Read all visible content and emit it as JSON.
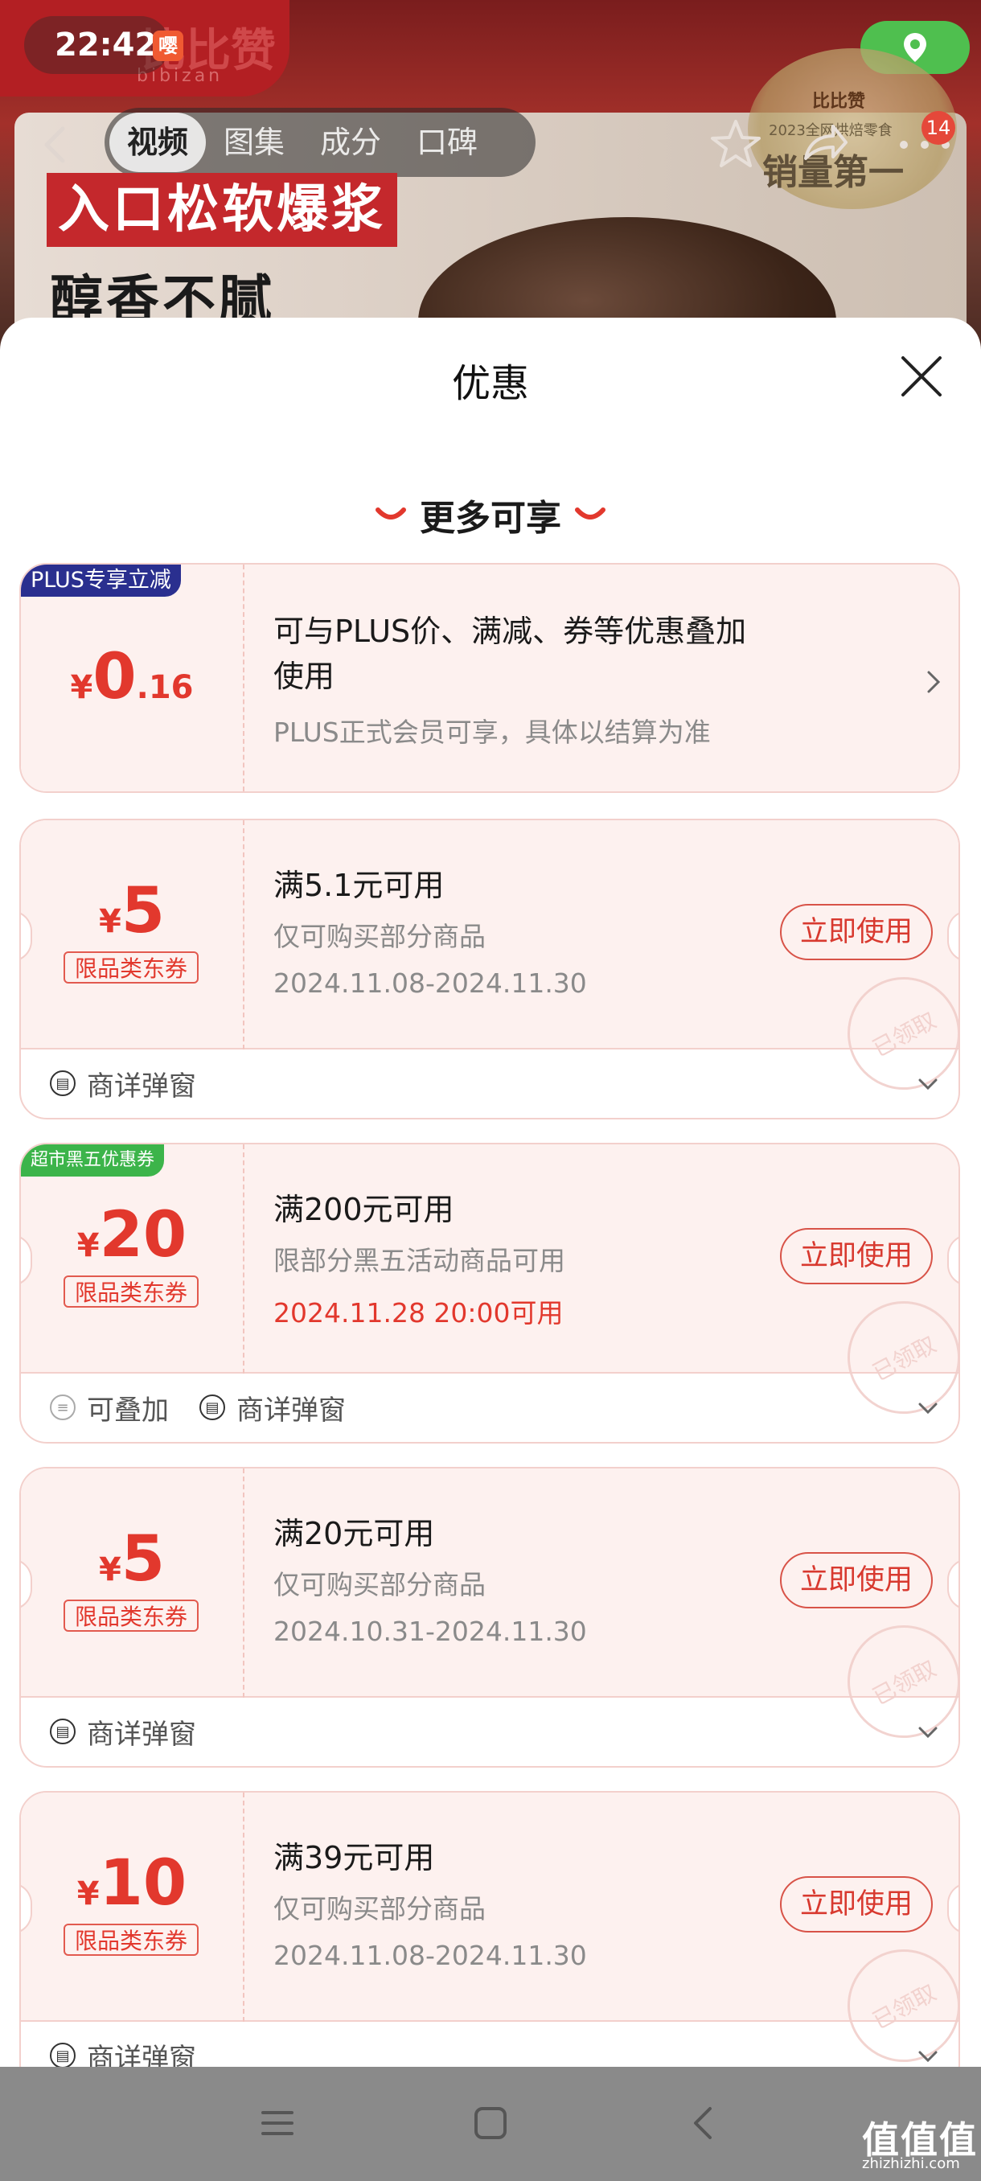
{
  "status_bar": {
    "time": "22:42",
    "notif_glyph": "嘤"
  },
  "brand": {
    "name": "比比赞",
    "sub": "bibizan"
  },
  "nav": {
    "tabs": [
      {
        "label": "视频",
        "active": true
      },
      {
        "label": "图集",
        "active": false
      },
      {
        "label": "成分",
        "active": false
      },
      {
        "label": "口碑",
        "active": false
      }
    ],
    "badge_count": "14"
  },
  "banner": {
    "slogan_1": "入口松软爆浆",
    "slogan_2": "醇香不腻",
    "award_brand": "比比赞",
    "award_year": "2023全网烘焙零食",
    "award_title": "销量第一"
  },
  "sheet": {
    "title": "优惠",
    "section_title": "更多可享"
  },
  "plus_offer": {
    "corner_tag": "PLUS专享立减",
    "currency": "¥",
    "amount_int": "0",
    "amount_dec": ".16",
    "title_line1": "可与PLUS价、满减、券等优惠叠加",
    "title_line2": "使用",
    "note": "PLUS正式会员可享，具体以结算为准"
  },
  "coupons": [
    {
      "currency": "¥",
      "amount": "5",
      "category": "限品类东券",
      "title": "满5.1元可用",
      "subtitle": "仅可购买部分商品",
      "date": "2024.11.08-2024.11.30",
      "button": "立即使用",
      "stamp": "已领取",
      "footer": [
        {
          "icon": "coupon-detail-icon",
          "label": "商详弹窗"
        }
      ]
    },
    {
      "corner_tag": "超市黑五优惠券",
      "currency": "¥",
      "amount": "20",
      "category": "限品类东券",
      "title": "满200元可用",
      "subtitle": "限部分黑五活动商品可用",
      "date": "2024.11.28 20:00可用",
      "button": "立即使用",
      "stamp": "已领取",
      "footer": [
        {
          "icon": "stackable-icon",
          "label": "可叠加"
        },
        {
          "icon": "coupon-detail-icon",
          "label": "商详弹窗"
        }
      ]
    },
    {
      "currency": "¥",
      "amount": "5",
      "category": "限品类东券",
      "title": "满20元可用",
      "subtitle": "仅可购买部分商品",
      "date": "2024.10.31-2024.11.30",
      "button": "立即使用",
      "stamp": "已领取",
      "footer": [
        {
          "icon": "coupon-detail-icon",
          "label": "商详弹窗"
        }
      ]
    },
    {
      "currency": "¥",
      "amount": "10",
      "category": "限品类东券",
      "title": "满39元可用",
      "subtitle": "仅可购买部分商品",
      "date": "2024.11.08-2024.11.30",
      "button": "立即使用",
      "stamp": "已领取",
      "footer": [
        {
          "icon": "coupon-detail-icon",
          "label": "商详弹窗"
        }
      ]
    }
  ],
  "watermark": {
    "text": "值值值",
    "sub": "zhizhizhi.com"
  },
  "colors": {
    "accent": "#e2382d",
    "coupon_bg": "#fdf1ef",
    "plus_blue": "#2a2f8f",
    "black_friday_green": "#3cb44a"
  }
}
